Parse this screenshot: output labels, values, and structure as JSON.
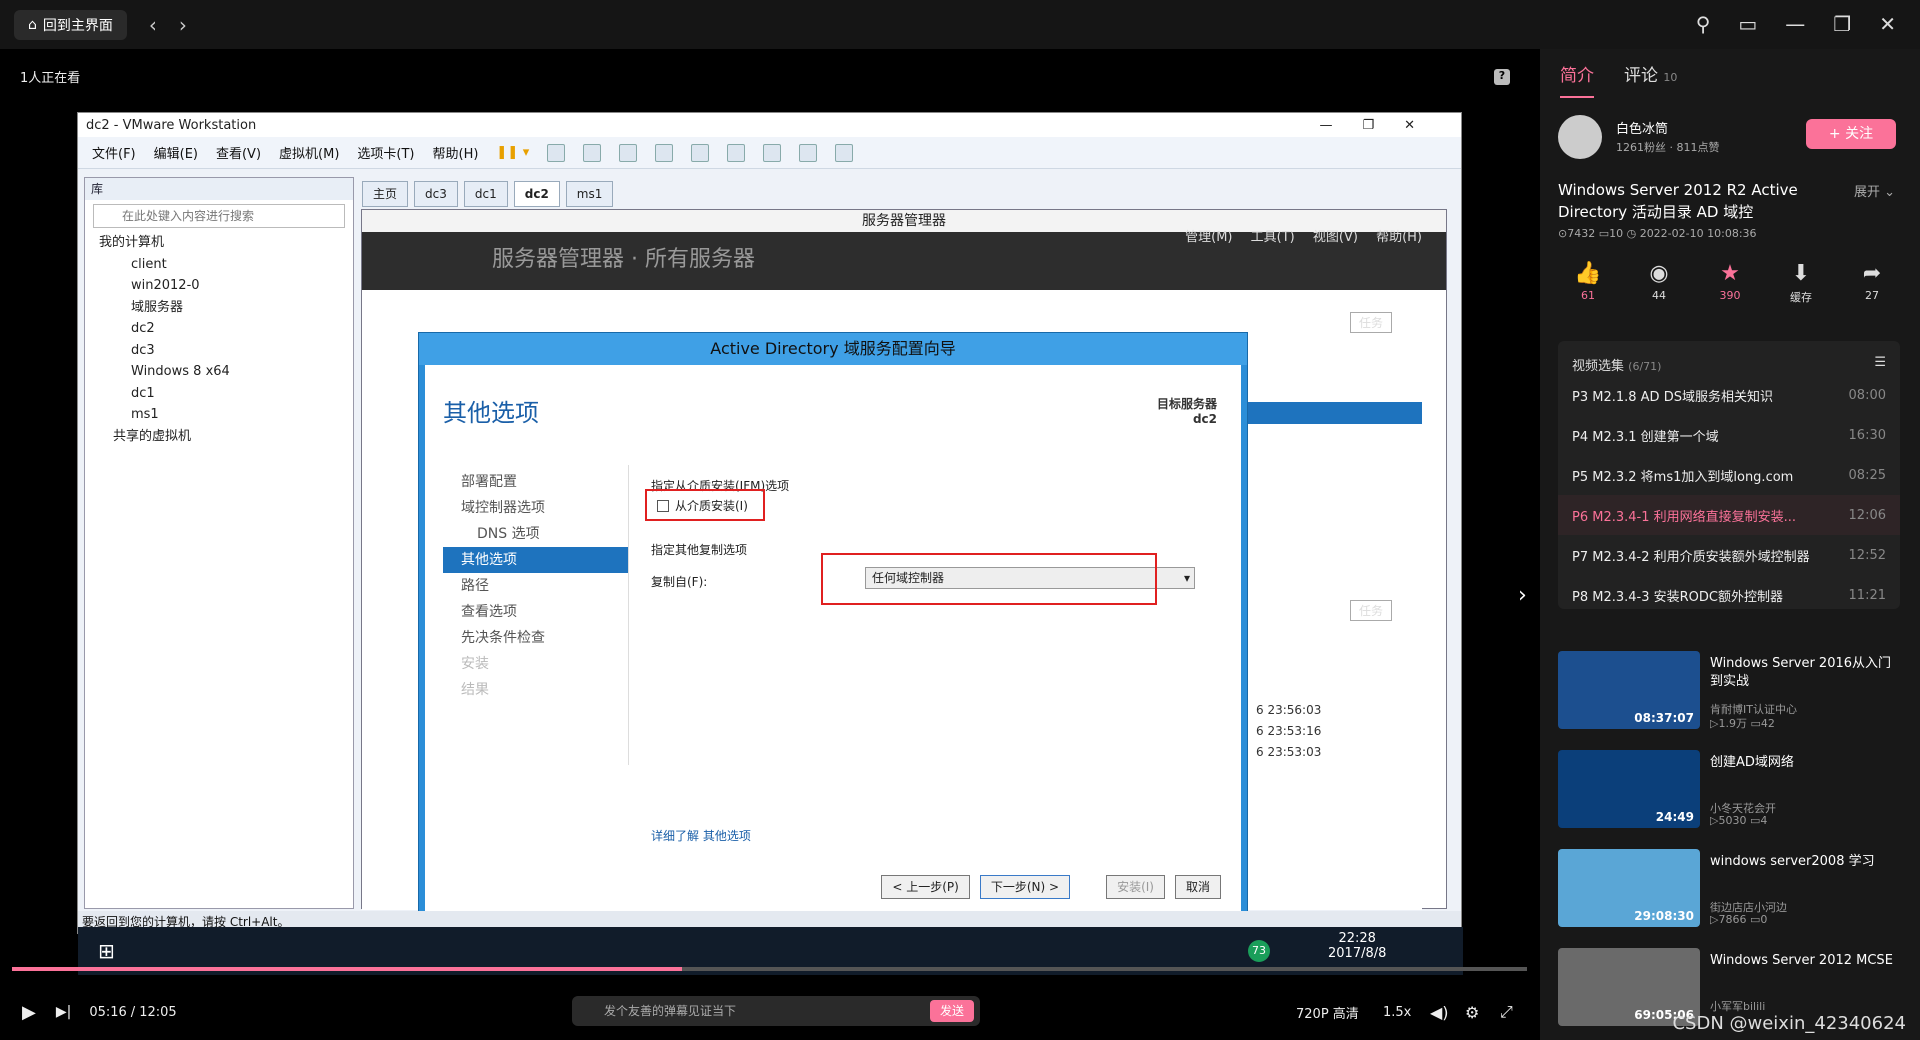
{
  "topbar": {
    "home_label": "回到主界面",
    "back": "‹",
    "forward": "›"
  },
  "player": {
    "watching": "1人正在看"
  },
  "vmware": {
    "title": "dc2 - VMware Workstation",
    "menu": [
      "文件(F)",
      "编辑(E)",
      "查看(V)",
      "虚拟机(M)",
      "选项卡(T)",
      "帮助(H)"
    ],
    "library_header": "库",
    "search_placeholder": "在此处键入内容进行搜索",
    "tree": [
      "我的计算机",
      "client",
      "win2012-0",
      "域服务器",
      "dc2",
      "dc3",
      "Windows 8 x64",
      "dc1",
      "ms1",
      "共享的虚拟机"
    ],
    "tabs": [
      "主页",
      "dc3",
      "dc1",
      "dc2",
      "ms1"
    ],
    "status": "要返回到您的计算机，请按 Ctrl+Alt。"
  },
  "server_manager": {
    "title": "服务器管理器",
    "header": "服务器管理器 · 所有服务器",
    "menu": [
      "管理(M)",
      "工具(T)",
      "视图(V)",
      "帮助(H)"
    ],
    "tasks": "任务"
  },
  "dialog": {
    "title": "Active Directory 域服务配置向导",
    "heading": "其他选项",
    "target_label": "目标服务器",
    "target_value": "dc2",
    "nav": [
      "部署配置",
      "域控制器选项",
      "DNS 选项",
      "其他选项",
      "路径",
      "查看选项",
      "先决条件检查",
      "安装",
      "结果"
    ],
    "ifm_section": "指定从介质安装(IFM)选项",
    "ifm_checkbox": "从介质安装(I)",
    "replication_section": "指定其他复制选项",
    "replicate_from_label": "复制自(F):",
    "replicate_from_value": "任何域控制器",
    "learn_more": "详细了解 其他选项",
    "buttons": {
      "prev": "< 上一步(P)",
      "next": "下一步(N) >",
      "install": "安装(I)",
      "cancel": "取消"
    }
  },
  "bg_times": [
    "6 23:56:03",
    "6 23:53:16",
    "6 23:53:03"
  ],
  "guest_taskbar": {
    "time": "22:28",
    "date": "2017/8/8",
    "badge": "73"
  },
  "controls": {
    "time_current": "05:16",
    "time_sep": "/",
    "time_total": "12:05",
    "danmaku_placeholder": "发个友善的弹幕见证当下",
    "send": "发送",
    "quality": "720P 高清",
    "speed": "1.5x"
  },
  "sidebar": {
    "tab_intro": "简介",
    "tab_comments": "评论",
    "comments_count": "10",
    "uploader": "白色冰筒",
    "uploader_stats": "1261粉丝 · 811点赞",
    "follow": "+ 关注",
    "video_title": "Windows Server 2012 R2 Active Directory 活动目录 AD 域控",
    "expand": "展开 ⌄",
    "meta": "⊙7432   ▭10   ◷ 2022-02-10 10:08:36",
    "actions": [
      {
        "icon": "like-icon",
        "glyph": "👍",
        "count": "61"
      },
      {
        "icon": "coin-icon",
        "glyph": "◉",
        "count": "44"
      },
      {
        "icon": "star-icon",
        "glyph": "★",
        "count": "390"
      },
      {
        "icon": "cache-icon",
        "glyph": "⬇",
        "count": "缓存"
      },
      {
        "icon": "share-icon",
        "glyph": "➦",
        "count": "27"
      }
    ],
    "playlist_title": "视频选集",
    "playlist_progress": "(6/71)",
    "playlist": [
      {
        "label": "P3  M2.1.8 AD DS域服务相关知识",
        "time": "08:00"
      },
      {
        "label": "P4  M2.3.1 创建第一个域",
        "time": "16:30"
      },
      {
        "label": "P5  M2.3.2 将ms1加入到域long.com",
        "time": "08:25"
      },
      {
        "label": "P6  M2.3.4-1 利用网络直接复制安装...",
        "time": "12:06"
      },
      {
        "label": "P7  M2.3.4-2 利用介质安装额外域控制器",
        "time": "12:52"
      },
      {
        "label": "P8  M2.3.4-3 安装RODC额外控制器",
        "time": "11:21"
      }
    ],
    "recommended": [
      {
        "title": "Windows Server 2016从入门到实战",
        "up": "肯耐博IT认证中心",
        "stats": "▷1.9万  ▭42",
        "dur": "08:37:07"
      },
      {
        "title": "创建AD域网络",
        "up": "小冬天花会开",
        "stats": "▷5030  ▭4",
        "dur": "24:49"
      },
      {
        "title": "windows server2008 学习",
        "up": "街边店店小河边",
        "stats": "▷7866  ▭0",
        "dur": "29:08:30"
      },
      {
        "title": "Windows Server 2012 MCSE",
        "up": "小军军bilili",
        "stats": "",
        "dur": "69:05:06"
      }
    ],
    "watermark": "CSDN @weixin_42340624"
  }
}
